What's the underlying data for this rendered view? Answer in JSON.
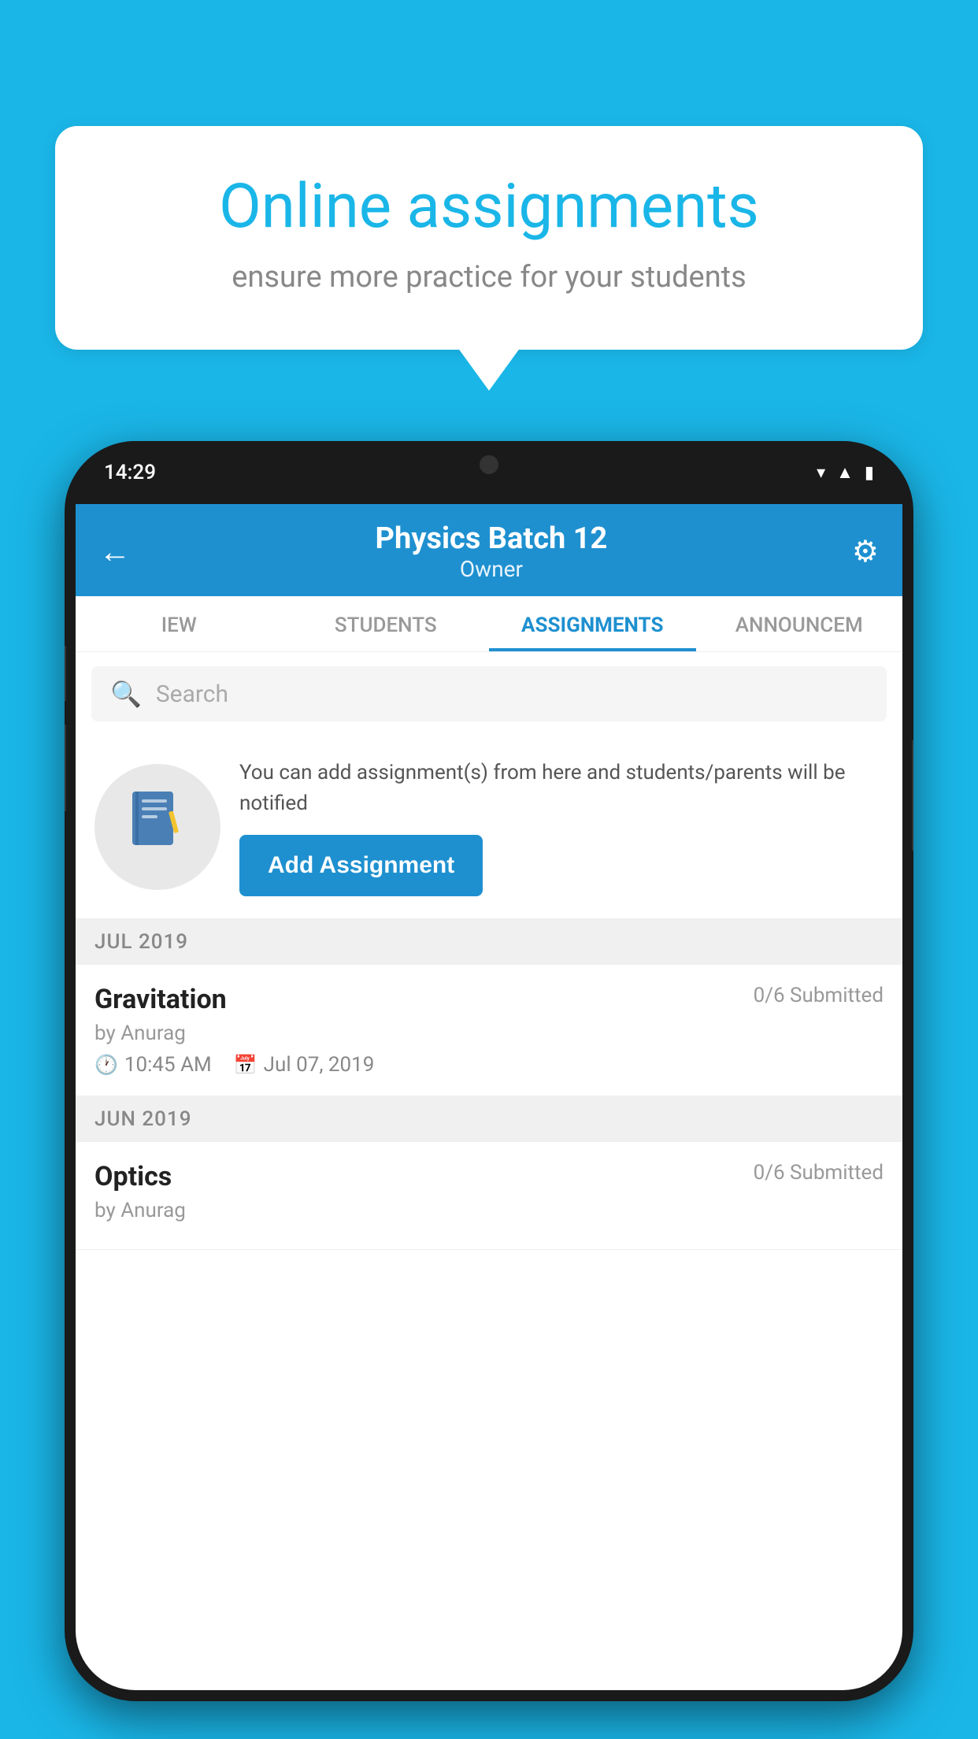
{
  "background": {
    "color": "#1ab6e8"
  },
  "speech_bubble": {
    "title": "Online assignments",
    "subtitle": "ensure more practice for your students"
  },
  "phone": {
    "status_bar": {
      "time": "14:29",
      "icons": [
        "wifi",
        "signal",
        "battery"
      ]
    },
    "header": {
      "title": "Physics Batch 12",
      "subtitle": "Owner",
      "back_label": "←",
      "settings_label": "⚙"
    },
    "tabs": [
      {
        "label": "IEW",
        "active": false
      },
      {
        "label": "STUDENTS",
        "active": false
      },
      {
        "label": "ASSIGNMENTS",
        "active": true
      },
      {
        "label": "ANNOUNCEM",
        "active": false
      }
    ],
    "search": {
      "placeholder": "Search"
    },
    "promo": {
      "icon": "📓",
      "description": "You can add assignment(s) from here and students/parents will be notified",
      "button_label": "Add Assignment"
    },
    "sections": [
      {
        "month_label": "JUL 2019",
        "assignments": [
          {
            "name": "Gravitation",
            "submitted": "0/6 Submitted",
            "by": "by Anurag",
            "time": "10:45 AM",
            "date": "Jul 07, 2019"
          }
        ]
      },
      {
        "month_label": "JUN 2019",
        "assignments": [
          {
            "name": "Optics",
            "submitted": "0/6 Submitted",
            "by": "by Anurag",
            "time": "",
            "date": ""
          }
        ]
      }
    ]
  }
}
